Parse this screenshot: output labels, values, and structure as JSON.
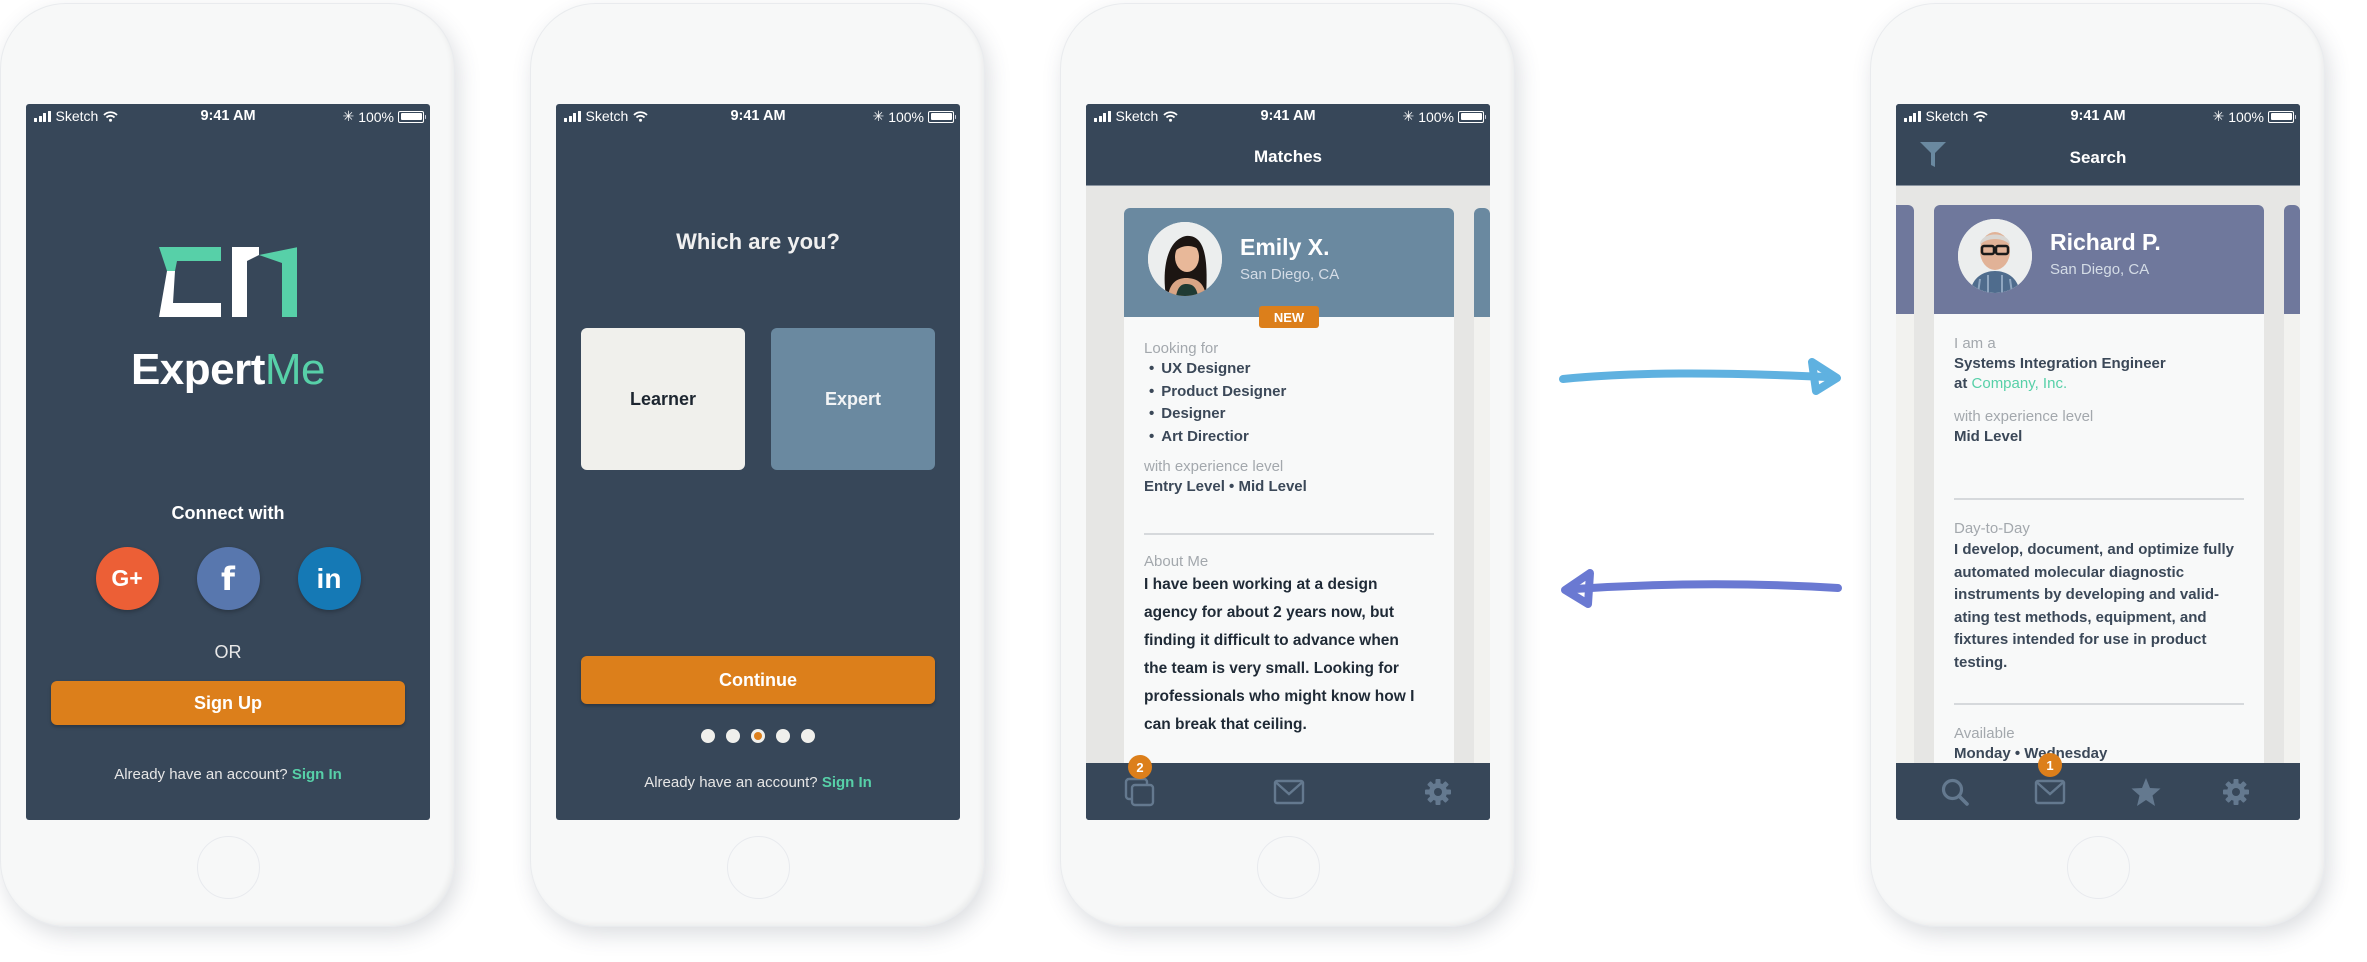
{
  "status_bar": {
    "carrier": "Sketch",
    "time": "9:41 AM",
    "battery": "100%"
  },
  "colors": {
    "screen_bg": "#374759",
    "accent_orange": "#dc7f1b",
    "accent_green": "#57d0a8",
    "google": "#ec5f36",
    "facebook": "#5877ae",
    "linkedin": "#1579b5",
    "expert_card": "#6a89a0",
    "learner_card": "#f0f0ec",
    "match_card_header": "#6a89a0",
    "search_card_header": "#6f789c",
    "arrow_forward": "#5fb1e0",
    "arrow_back": "#6a79d2"
  },
  "screen_login": {
    "brand_prefix": "Expert",
    "brand_suffix": "Me",
    "connect_label": "Connect with",
    "social_buttons": [
      {
        "name": "google-plus",
        "label": "G+"
      },
      {
        "name": "facebook",
        "label": "f"
      },
      {
        "name": "linkedin",
        "label": "in"
      }
    ],
    "or_label": "OR",
    "sign_up_label": "Sign Up",
    "already_text": "Already have an account?",
    "sign_in_label": "Sign In"
  },
  "screen_role": {
    "heading": "Which are you?",
    "options": [
      {
        "label": "Learner",
        "selected": false
      },
      {
        "label": "Expert",
        "selected": true
      }
    ],
    "continue_label": "Continue",
    "pagination": {
      "total": 5,
      "current": 3
    },
    "already_text": "Already have an account?",
    "sign_in_label": "Sign In"
  },
  "screen_matches": {
    "title": "Matches",
    "profile": {
      "name": "Emily X.",
      "location": "San Diego, CA",
      "badge": "NEW",
      "looking_for_label": "Looking for",
      "looking_for": [
        "UX Designer",
        "Product Designer",
        "Designer",
        "Art Directior"
      ],
      "experience_label": "with experience level",
      "experience": "Entry Level • Mid Level",
      "about_label": "About Me",
      "about": "I have been working at a design agency for about 2 years now, but finding it difficult to advance when the team is very small. Looking for professionals who might know how I can break that ceiling."
    },
    "tabs": [
      {
        "name": "matches",
        "icon": "cards-icon",
        "badge": "2"
      },
      {
        "name": "messages",
        "icon": "mail-icon"
      },
      {
        "name": "settings",
        "icon": "gear-icon"
      }
    ]
  },
  "screen_search": {
    "title": "Search",
    "profile": {
      "name": "Richard P.",
      "location": "San Diego, CA",
      "role_label": "I am a",
      "role": "Systems Integration Engineer",
      "company_prefix": "at",
      "company": "Company, Inc.",
      "experience_label": "with experience level",
      "experience": "Mid Level",
      "day_label": "Day-to-Day",
      "day_text": "I develop, document, and optimize fully automated molecular diagnostic instruments by developing and valid-ating test methods, equipment, and fixtures intended for use in product testing.",
      "available_label": "Available",
      "available": "Monday • Wednesday"
    },
    "tabs": [
      {
        "name": "search",
        "icon": "search-icon"
      },
      {
        "name": "messages",
        "icon": "mail-icon",
        "badge": "1"
      },
      {
        "name": "favorites",
        "icon": "star-icon"
      },
      {
        "name": "settings",
        "icon": "gear-icon"
      }
    ]
  }
}
